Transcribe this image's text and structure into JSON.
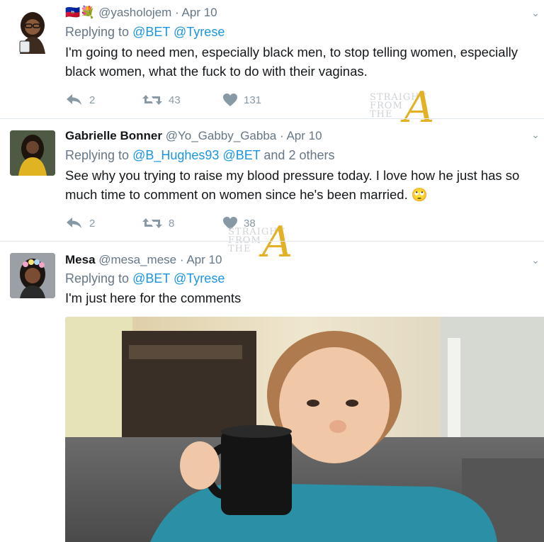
{
  "tweets": [
    {
      "flags": "🇭🇹💐",
      "handle": "@yasholojem",
      "dot": "·",
      "time": "Apr 10",
      "replying_prefix": "Replying to",
      "replying_to": "@BET @Tyrese",
      "text": "I'm going to need men, especially black men, to stop telling women, especially black women, what the fuck to do with their vaginas.",
      "replies": "2",
      "retweets": "43",
      "likes": "131"
    },
    {
      "name": "Gabrielle Bonner",
      "handle": "@Yo_Gabby_Gabba",
      "dot": "·",
      "time": "Apr 10",
      "replying_prefix": "Replying to",
      "replying_to": "@B_Hughes93 @BET",
      "replying_suffix": "and 2 others",
      "text": "See why you trying to raise my blood pressure today. I love how he just has so much time to comment on women since he's been married.",
      "emoji": "🙄",
      "replies": "2",
      "retweets": "8",
      "likes": "38"
    },
    {
      "name": "Mesa",
      "handle": "@mesa_mese",
      "dot": "·",
      "time": "Apr 10",
      "replying_prefix": "Replying to",
      "replying_to": "@BET @Tyrese",
      "text": "I'm just here for the comments"
    }
  ],
  "watermark": {
    "line1": "STRAIGHT",
    "line2": "FROM",
    "line3": "THE",
    "letter": "A"
  },
  "colors": {
    "link": "#1b95e0",
    "muted": "#657786",
    "icon": "#8899a6",
    "divider": "#e1e8ed",
    "watermark_gold": "#e4b126"
  }
}
